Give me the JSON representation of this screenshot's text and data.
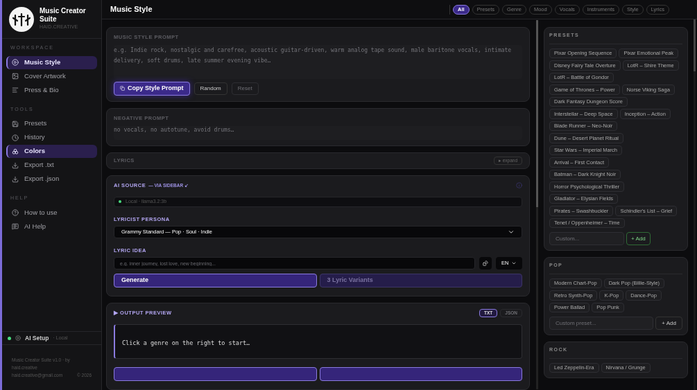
{
  "brand": {
    "title": "Music Creator Suite",
    "subtitle": "HAID.CREATIVE"
  },
  "sidebar": {
    "sections": [
      {
        "title": "WORKSPACE",
        "items": [
          {
            "label": "Music Style",
            "selected": true
          },
          {
            "label": "Cover Artwork",
            "selected": false
          },
          {
            "label": "Press & Bio",
            "selected": false
          }
        ]
      },
      {
        "title": "TOOLS",
        "items": [
          {
            "label": "Presets",
            "selected": false
          },
          {
            "label": "History",
            "selected": false
          },
          {
            "label": "Colors",
            "selected": true
          },
          {
            "label": "Export .txt",
            "selected": false
          },
          {
            "label": "Export .json",
            "selected": false
          }
        ]
      },
      {
        "title": "HELP",
        "items": [
          {
            "label": "How to use",
            "selected": false
          },
          {
            "label": "AI Help",
            "selected": false
          }
        ]
      }
    ],
    "ai_setup": {
      "label": "AI Setup",
      "mode": "· Local",
      "connected": true
    },
    "footer": {
      "credit": "Music Creator Suite v1.0 · by haid.creative",
      "email": "haid.creative@gmail.com",
      "copyright": "© 2026"
    }
  },
  "header": {
    "title": "Music Style",
    "filters": [
      {
        "label": "All",
        "selected": true
      },
      {
        "label": "Presets",
        "selected": false
      },
      {
        "label": "Genre",
        "selected": false
      },
      {
        "label": "Mood",
        "selected": false
      },
      {
        "label": "Vocals",
        "selected": false
      },
      {
        "label": "Instruments",
        "selected": false
      },
      {
        "label": "Style",
        "selected": false
      },
      {
        "label": "Lyrics",
        "selected": false
      }
    ]
  },
  "style_prompt": {
    "label": "MUSIC STYLE PROMPT",
    "placeholder": "e.g. Indie rock, nostalgic and carefree, acoustic guitar-driven, warm analog tape sound, male baritone vocals, intimate delivery, soft drums, late summer evening vibe…",
    "buttons": [
      {
        "label": "Copy Style Prompt",
        "kind": "primary",
        "disabled": false
      },
      {
        "label": "Random",
        "kind": "secondary",
        "disabled": false
      },
      {
        "label": "Reset",
        "kind": "secondary",
        "disabled": true
      }
    ]
  },
  "negative_prompt": {
    "label": "NEGATIVE PROMPT",
    "placeholder": "no vocals, no autotune, avoid drums…"
  },
  "lyrics": {
    "label": "LYRICS",
    "expand": "▸ expand"
  },
  "ai_source": {
    "title": "AI SOURCE",
    "subtitle": "— VIA SIDEBAR ↙",
    "source": "Local · llama3.2:3b",
    "connected": true,
    "persona_label": "LYRICIST PERSONA",
    "persona": "Grammy Standard — Pop · Soul · Indie",
    "idea_label": "LYRIC IDEA",
    "idea_placeholder": "e.g. inner journey, lost love, new beginning...",
    "language": "EN",
    "generate": "Generate",
    "variants": "3 Lyric Variants"
  },
  "output": {
    "title": "▶ OUTPUT PREVIEW",
    "formats": [
      {
        "label": "TXT",
        "selected": true
      },
      {
        "label": "JSON",
        "selected": false
      }
    ],
    "text": "Click a genre on the right to start…"
  },
  "categories": [
    {
      "title": "PRESETS",
      "chips": [
        "Pixar Opening Sequence",
        "Pixar Emotional Peak",
        "Disney Fairy Tale Overture",
        "LotR – Shire Theme",
        "LotR – Battle of Gondor",
        "Game of Thrones – Power",
        "Norse Viking Saga",
        "Dark Fantasy Dungeon Score",
        "Interstellar – Deep Space",
        "Inception – Action",
        "Blade Runner – Neo-Noir",
        "Dune – Desert Planet Ritual",
        "Star Wars – Imperial March",
        "Arrival – First Contact",
        "Batman – Dark Knight Noir",
        "Horror Psychological Thriller",
        "Gladiator – Elysian Fields",
        "Pirates – Swashbuckler",
        "Schindler's List – Grief",
        "Tenet / Oppenheimer – Time"
      ],
      "placeholder": "Custom...",
      "add": "+ Add",
      "kind": "green"
    },
    {
      "title": "POP",
      "chips": [
        "Modern Chart-Pop",
        "Dark Pop (Billie-Style)",
        "Retro Synth-Pop",
        "K-Pop",
        "Dance-Pop",
        "Power Ballad",
        "Pop Punk"
      ],
      "placeholder": "Custom preset...",
      "add": "+ Add",
      "kind": "wide"
    },
    {
      "title": "ROCK",
      "chips": [
        "Led Zeppelin-Era",
        "Nirvana / Grunge"
      ]
    }
  ]
}
